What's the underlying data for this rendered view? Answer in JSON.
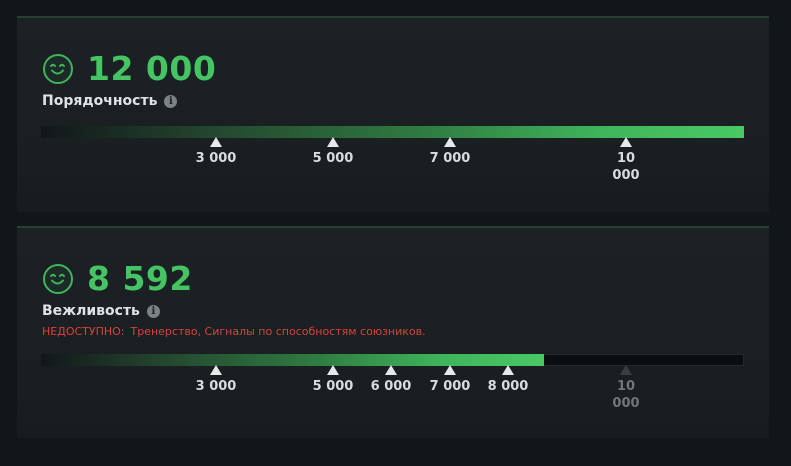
{
  "panels": [
    {
      "score": "12 000",
      "title": "Порядочность",
      "info_icon": "info-icon",
      "icon": "smiley-icon",
      "accent": "#46c463",
      "progress": 1.0,
      "markers": [
        {
          "label": "3 000",
          "value": 3000
        },
        {
          "label": "5 000",
          "value": 5000
        },
        {
          "label": "7 000",
          "value": 7000
        },
        {
          "label": "10 000",
          "value": 10000
        }
      ]
    },
    {
      "score": "8 592",
      "title": "Вежливость",
      "info_icon": "info-icon",
      "icon": "smiley-icon",
      "accent": "#46c463",
      "warning_label": "НЕДОСТУПНО:",
      "warning_detail": "Тренерство, Сигналы по способностям союзников.",
      "warning_color": "#d9423d",
      "progress": 0.715,
      "markers": [
        {
          "label": "3 000",
          "value": 3000
        },
        {
          "label": "5 000",
          "value": 5000
        },
        {
          "label": "6 000",
          "value": 6000
        },
        {
          "label": "7 000",
          "value": 7000
        },
        {
          "label": "8 000",
          "value": 8000
        },
        {
          "label": "10 000",
          "value": 10000,
          "reached": false
        }
      ]
    }
  ]
}
